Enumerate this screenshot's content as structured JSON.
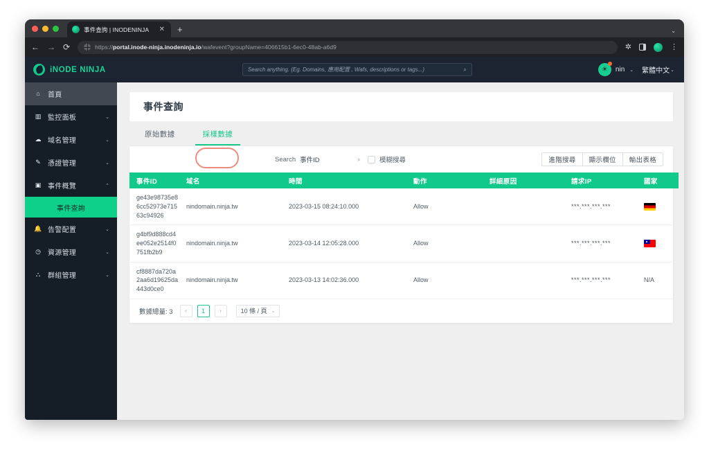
{
  "browser": {
    "tab_title": "事件查詢 | INODENINJA",
    "tab_close": "✕",
    "new_tab": "+",
    "tabstrip_caret": "⌄",
    "back": "←",
    "forward": "→",
    "reload": "⟳",
    "url_scheme": "https://",
    "url_host": "portal.inode-ninja.inodeninja.io",
    "url_path": "/wafevent?groupName=406615b1-6ec0-48ab-a6d9",
    "extensions_icon": "🧩",
    "kebab": "⋮"
  },
  "appbar": {
    "brand": "iNODE NINJA",
    "search_placeholder": "Search anything. (Eg. Domains, 應用配置 , Wafs, descriptions or tags...)",
    "search_value": "",
    "search_icon": "⌕",
    "user_name": "nin",
    "user_caret": "⌄",
    "language": "繁體中文",
    "language_caret": "⌄",
    "avatar_glyph": "☀"
  },
  "sidebar": {
    "items": [
      {
        "label": "首頁",
        "icon": "⌂",
        "caret": "",
        "active": true
      },
      {
        "label": "監控面板",
        "icon": "▥",
        "caret": "⌄",
        "active": false
      },
      {
        "label": "域名管理",
        "icon": "☁",
        "caret": "⌄",
        "active": false
      },
      {
        "label": "憑證管理",
        "icon": "✎",
        "caret": "⌄",
        "active": false
      },
      {
        "label": "事件概覽",
        "icon": "▣",
        "caret": "⌃",
        "active": false
      },
      {
        "label": "告警配置",
        "icon": "🔔",
        "caret": "⌄",
        "active": false
      },
      {
        "label": "資源管理",
        "icon": "◷",
        "caret": "⌄",
        "active": false
      },
      {
        "label": "群組管理",
        "icon": "⛬",
        "caret": "⌄",
        "active": false
      }
    ],
    "submenu_label": "事件查詢"
  },
  "page": {
    "title": "事件查詢",
    "tabs": [
      {
        "label": "原始數據",
        "active": false
      },
      {
        "label": "採樣數據",
        "active": true
      }
    ]
  },
  "toolbar": {
    "search_label": "Search",
    "search_value": "事件ID",
    "search_icon": "⌕",
    "fuzzy_label": "模糊搜尋",
    "fuzzy_checked": false,
    "buttons": [
      "進階搜尋",
      "顯示欄位",
      "輸出表格"
    ]
  },
  "table": {
    "columns": [
      "事件ID",
      "域名",
      "時間",
      "動作",
      "詳細原因",
      "請求IP",
      "國家"
    ],
    "rows": [
      {
        "event_id": "ge43e98735e86cc52973e71563c94926",
        "domain": "nindomain.ninja.tw",
        "time": "2023-03-15 08:24:10.000",
        "action": "Allow",
        "reason": "",
        "ip": "***.***.***.***",
        "country": "DE",
        "country_text": ""
      },
      {
        "event_id": "g4bf9d888cd4ee052e2514f0751fb2b9",
        "domain": "nindomain.ninja.tw",
        "time": "2023-03-14 12:05:28.000",
        "action": "Allow",
        "reason": "",
        "ip": "***.***.***.***",
        "country": "TW",
        "country_text": ""
      },
      {
        "event_id": "cf8887da720a2aa6d19625da443d0ce0",
        "domain": "nindomain.ninja.tw",
        "time": "2023-03-13 14:02:36.000",
        "action": "Allow",
        "reason": "",
        "ip": "***.***.***.***",
        "country": "NA",
        "country_text": "N/A"
      }
    ]
  },
  "pagination": {
    "total_label": "數據總量: 3",
    "prev": "‹",
    "next": "›",
    "current_page": "1",
    "page_size": "10 條 / 頁",
    "page_size_caret": "⌄"
  },
  "colors": {
    "accent_green": "#12c98c",
    "sidebar_bg": "#151d27",
    "appbar_bg": "#1b2430",
    "annotation_red": "#f08a80"
  }
}
